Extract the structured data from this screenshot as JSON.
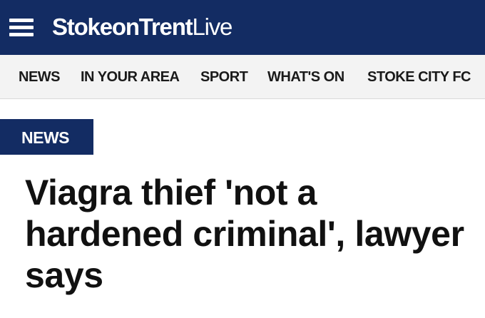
{
  "header": {
    "menu_icon": "hamburger-menu-icon",
    "logo_bold": "StokeonTrent",
    "logo_light": "Live",
    "background_color": "#132c63"
  },
  "nav": {
    "items": [
      {
        "label": "NEWS"
      },
      {
        "label": "IN YOUR AREA"
      },
      {
        "label": "SPORT"
      },
      {
        "label": "WHAT'S ON"
      },
      {
        "label": "STOKE CITY FC"
      }
    ],
    "background_color": "#f3f3f3"
  },
  "article": {
    "section": "NEWS",
    "headline": "Viagra thief 'not a hardened criminal', lawyer says"
  }
}
